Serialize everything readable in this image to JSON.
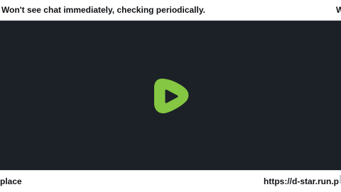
{
  "top_banner": {
    "text": "Won't see chat immediately, checking periodically.",
    "text_right": "W"
  },
  "player": {
    "logo_icon": "rumble-play-icon",
    "logo_color": "#85c742",
    "background": "#1b2126"
  },
  "bottom_banner": {
    "left_text": "place",
    "right_text": "https://d-star.run.p"
  }
}
